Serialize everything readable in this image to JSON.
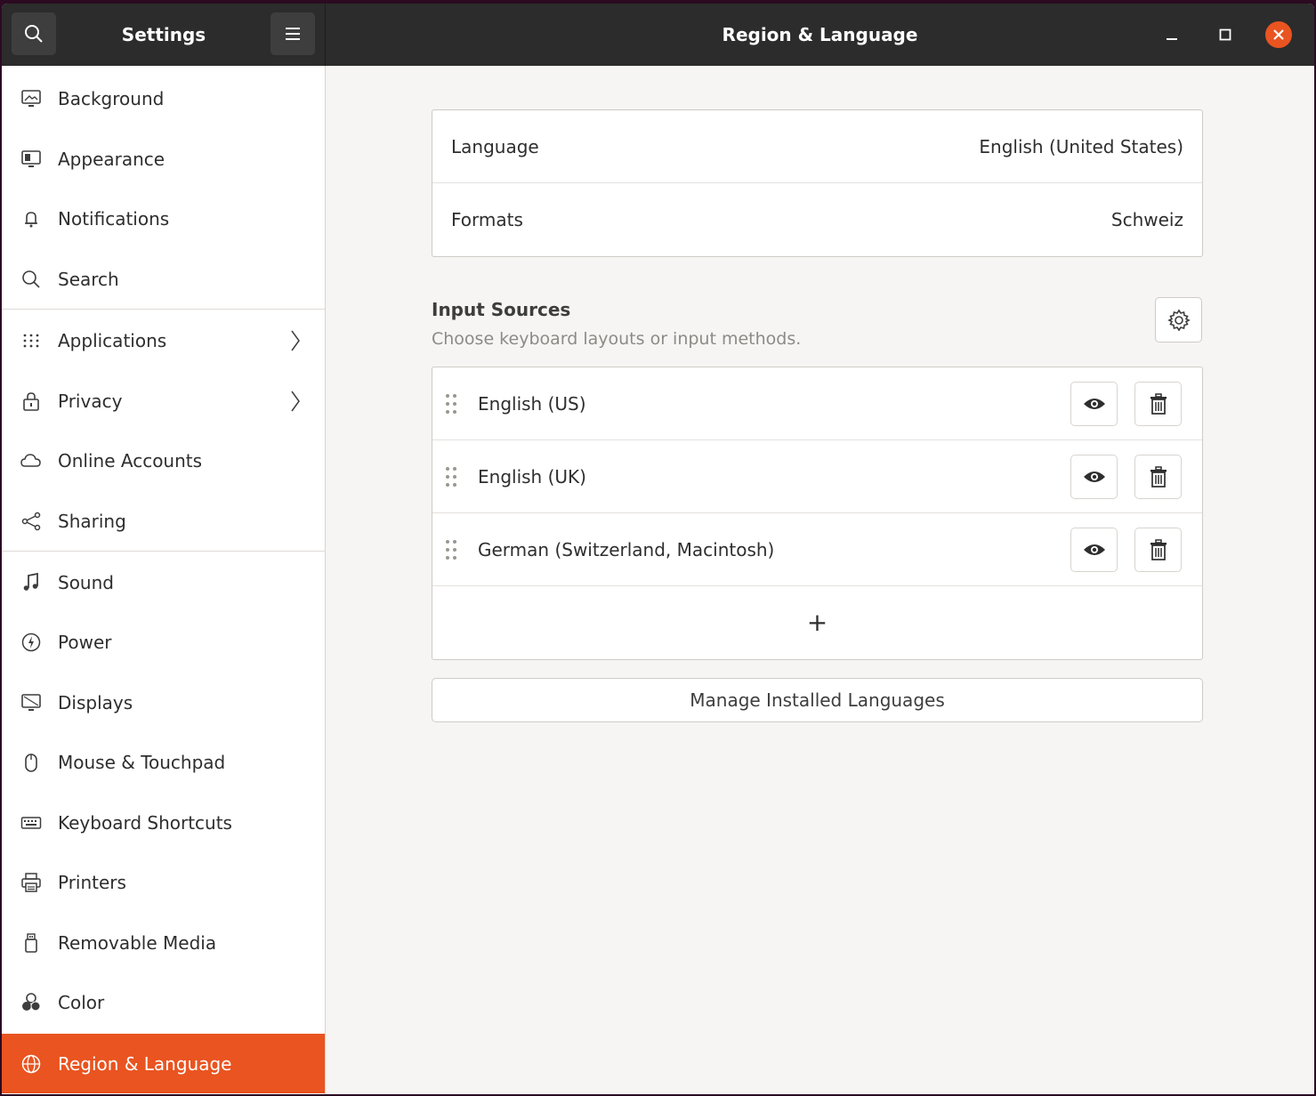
{
  "header": {
    "sidebar_title": "Settings",
    "page_title": "Region & Language"
  },
  "sidebar": {
    "items": [
      {
        "label": "Background",
        "icon": "monitor-icon"
      },
      {
        "label": "Appearance",
        "icon": "appearance-icon"
      },
      {
        "label": "Notifications",
        "icon": "bell-icon"
      },
      {
        "label": "Search",
        "icon": "search-icon"
      },
      {
        "label": "Applications",
        "icon": "grid-icon",
        "has_submenu": true
      },
      {
        "label": "Privacy",
        "icon": "lock-icon",
        "has_submenu": true
      },
      {
        "label": "Online Accounts",
        "icon": "cloud-icon"
      },
      {
        "label": "Sharing",
        "icon": "share-icon"
      },
      {
        "label": "Sound",
        "icon": "music-note-icon"
      },
      {
        "label": "Power",
        "icon": "power-icon"
      },
      {
        "label": "Displays",
        "icon": "display-icon"
      },
      {
        "label": "Mouse & Touchpad",
        "icon": "mouse-icon"
      },
      {
        "label": "Keyboard Shortcuts",
        "icon": "keyboard-icon"
      },
      {
        "label": "Printers",
        "icon": "printer-icon"
      },
      {
        "label": "Removable Media",
        "icon": "usb-drive-icon"
      },
      {
        "label": "Color",
        "icon": "color-icon"
      },
      {
        "label": "Region & Language",
        "icon": "globe-icon",
        "active": true
      }
    ]
  },
  "language_card": {
    "language_label": "Language",
    "language_value": "English (United States)",
    "formats_label": "Formats",
    "formats_value": "Schweiz"
  },
  "input_sources": {
    "title": "Input Sources",
    "subtitle": "Choose keyboard layouts or input methods.",
    "sources": [
      {
        "label": "English (US)"
      },
      {
        "label": "English (UK)"
      },
      {
        "label": "German (Switzerland, Macintosh)"
      }
    ],
    "add_symbol": "+"
  },
  "manage_button": "Manage Installed Languages",
  "colors": {
    "accent": "#e95420",
    "headerbar": "#2c2c2c"
  }
}
